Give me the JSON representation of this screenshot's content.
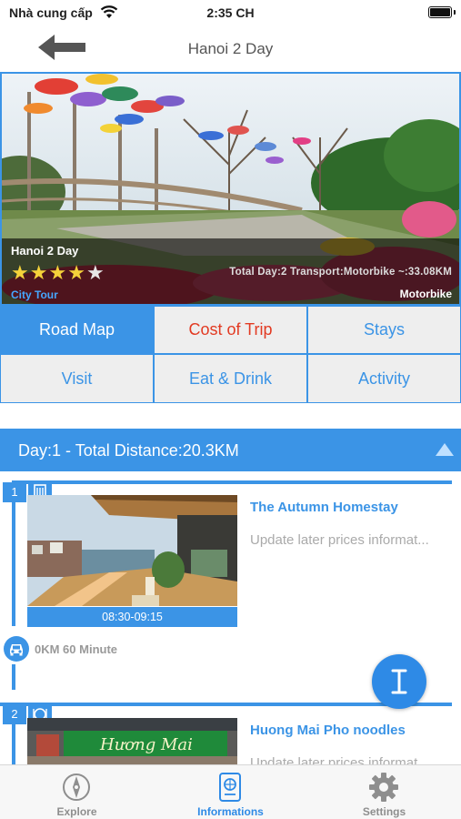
{
  "status_bar": {
    "carrier": "Nhà cung cấp",
    "time": "2:35 CH"
  },
  "nav": {
    "title": "Hanoi 2 Day",
    "back_icon": "back-arrow-icon"
  },
  "tour": {
    "name": "Hanoi 2 Day",
    "rating": 4,
    "rating_max": 5,
    "category": "City Tour",
    "summary": "Total Day:2 Transport:Motorbike ~:33.08KM",
    "transport": "Motorbike"
  },
  "tabs": [
    {
      "label": "Road Map",
      "active": true
    },
    {
      "label": "Cost of Trip",
      "active": false
    },
    {
      "label": "Stays",
      "active": false
    },
    {
      "label": "Visit",
      "active": false
    },
    {
      "label": "Eat & Drink",
      "active": false
    },
    {
      "label": "Activity",
      "active": false
    }
  ],
  "day": {
    "label": "Day:1 - Total Distance:20.3KM"
  },
  "stops": [
    {
      "number": "1",
      "icon": "hotel-icon",
      "name": "The Autumn Homestay",
      "info": "Update later prices informat...",
      "time": "08:30-09:15"
    },
    {
      "number": "2",
      "icon": "restaurant-icon",
      "name": "Huong Mai Pho noodles",
      "info": "Update later prices informat..."
    }
  ],
  "transit": {
    "icon": "car-icon",
    "text": "0KM 60 Minute"
  },
  "fab": {
    "icon": "text-cursor-icon"
  },
  "tabbar": [
    {
      "label": "Explore",
      "icon": "compass-icon",
      "active": false
    },
    {
      "label": "Informations",
      "icon": "passport-icon",
      "active": true
    },
    {
      "label": "Settings",
      "icon": "gear-icon",
      "active": false
    }
  ],
  "colors": {
    "accent": "#3b94e6",
    "cost_text": "#e23a22",
    "star": "#f5d23a"
  }
}
